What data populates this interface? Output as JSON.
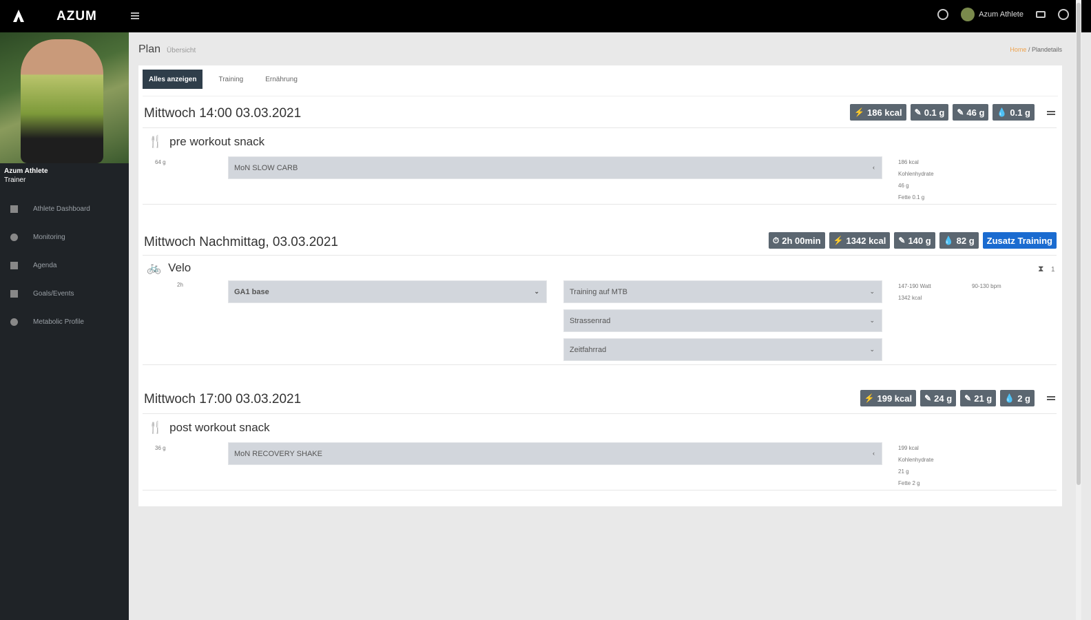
{
  "app": {
    "brand": "AZUM"
  },
  "topbar": {
    "user_name": "Azum Athlete"
  },
  "sidebar": {
    "profile_name": "Azum Athlete",
    "profile_role": "Trainer",
    "items": [
      {
        "label": "Athlete Dashboard",
        "icon": "dashboard-icon"
      },
      {
        "label": "Monitoring",
        "icon": "heart-icon"
      },
      {
        "label": "Agenda",
        "icon": "calendar-icon"
      },
      {
        "label": "Goals/Events",
        "icon": "flag-icon"
      },
      {
        "label": "Metabolic Profile",
        "icon": "user-icon"
      }
    ]
  },
  "page": {
    "title": "Plan",
    "subtitle": "Übersicht"
  },
  "breadcrumb": {
    "home": "Home",
    "separator": "/",
    "current": "Plandetails"
  },
  "tabs": [
    {
      "label": "Alles anzeigen",
      "active": true
    },
    {
      "label": "Training",
      "active": false
    },
    {
      "label": "Ernährung",
      "active": false
    }
  ],
  "sections": [
    {
      "title": "Mittwoch 14:00 03.03.2021",
      "badges": [
        {
          "icon": "⚡",
          "text": "186 kcal"
        },
        {
          "icon": "✎",
          "text": "0.1 g"
        },
        {
          "icon": "✎",
          "text": "46 g"
        },
        {
          "icon": "💧",
          "text": "0.1 g"
        }
      ],
      "item": {
        "name": "pre workout snack",
        "amount": "64 g",
        "select": "MoN SLOW CARB",
        "info": [
          "186 kcal",
          "Kohlenhydrate",
          "46 g",
          "Fette 0.1 g"
        ]
      }
    },
    {
      "title": "Mittwoch Nachmittag, 03.03.2021",
      "badges": [
        {
          "icon": "⏱",
          "text": "2h 00min"
        },
        {
          "icon": "⚡",
          "text": "1342 kcal"
        },
        {
          "icon": "✎",
          "text": "140 g"
        },
        {
          "icon": "💧",
          "text": "82 g"
        },
        {
          "icon": "",
          "text": "Zusatz Training",
          "blue": true
        }
      ],
      "item": {
        "name": "Velo",
        "amount": "2h",
        "select_left": "GA1 base",
        "selects_right": [
          "Training auf MTB",
          "Strassenrad",
          "Zeitfahrrad"
        ],
        "info": [
          "147-190 Watt",
          "1342 kcal"
        ],
        "info_right": "90-130 bpm",
        "count": "1"
      }
    },
    {
      "title": "Mittwoch 17:00 03.03.2021",
      "badges": [
        {
          "icon": "⚡",
          "text": "199 kcal"
        },
        {
          "icon": "✎",
          "text": "24 g"
        },
        {
          "icon": "✎",
          "text": "21 g"
        },
        {
          "icon": "💧",
          "text": "2 g"
        }
      ],
      "item": {
        "name": "post workout snack",
        "amount": "36 g",
        "select": "MoN RECOVERY SHAKE",
        "info": [
          "199 kcal",
          "Kohlenhydrate",
          "21 g",
          "Fette 2 g"
        ]
      }
    }
  ]
}
